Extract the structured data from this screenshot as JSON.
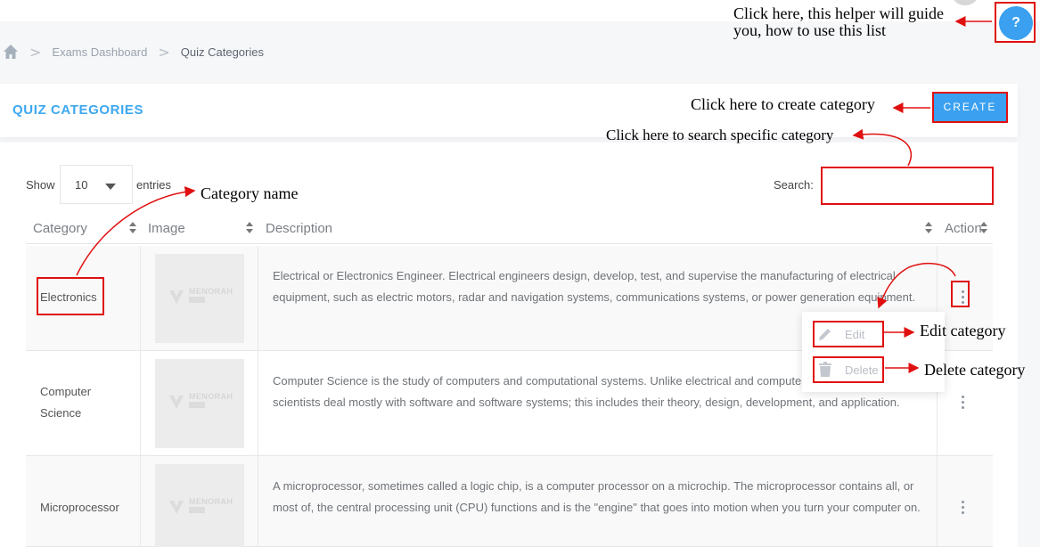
{
  "breadcrumb": {
    "home_icon": "home-icon",
    "items": [
      "Exams Dashboard",
      "Quiz Categories"
    ],
    "separator": ">"
  },
  "header": {
    "title": "QUIZ CATEGORIES",
    "create_label": "CREATE"
  },
  "help": {
    "label": "?"
  },
  "table_controls": {
    "show_label": "Show",
    "entries_value": "10",
    "entries_label": "entries",
    "search_label": "Search:",
    "search_value": ""
  },
  "columns": [
    "Category",
    "Image",
    "Description",
    "Action"
  ],
  "rows": [
    {
      "category": "Electronics",
      "description": "Electrical or Electronics Engineer. Electrical engineers design, develop, test, and supervise the manufacturing of electrical equipment, such as electric motors, radar and navigation systems, communications systems, or power generation equipment."
    },
    {
      "category": "Computer Science",
      "description": "Computer Science is the study of computers and computational systems. Unlike electrical and computer engineers, computer scientists deal mostly with software and software systems; this includes their theory, design, development, and application."
    },
    {
      "category": "Microprocessor",
      "description": "A microprocessor, sometimes called a logic chip, is a computer processor on a microchip. The microprocessor contains all, or most of, the central processing unit (CPU) functions and is the \"engine\" that goes into motion when you turn your computer on."
    }
  ],
  "thumbnail": {
    "logo_text": "MENORAH"
  },
  "action_menu": {
    "edit_label": "Edit",
    "delete_label": "Delete"
  },
  "annotations": {
    "helper_line1": "Click here, this helper will guide",
    "helper_line2": "you, how to use this list",
    "create": "Click here to create category",
    "search": "Click here to  search specific category",
    "category_name": "Category name",
    "edit": "Edit category",
    "delete": "Delete category"
  },
  "colors": {
    "accent": "#3aa0ef",
    "annotation_red": "#e01010"
  }
}
